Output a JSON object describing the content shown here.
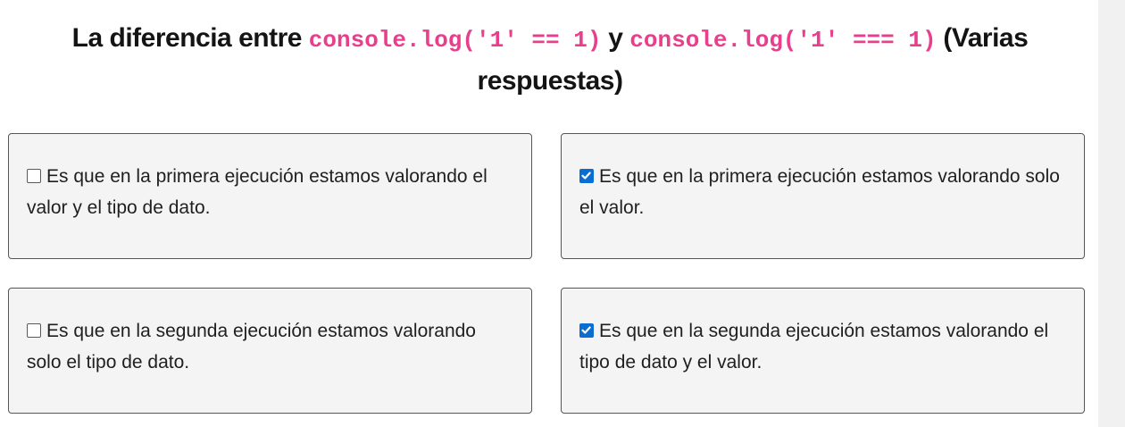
{
  "question": {
    "prefix": "La diferencia entre ",
    "code1": "console.log('1' == 1)",
    "connector": " y ",
    "code2": "console.log('1' === 1)",
    "suffix": " (Varias respuestas)"
  },
  "options": [
    {
      "text": "Es que en la primera ejecución estamos valorando el valor y el tipo de dato.",
      "checked": false
    },
    {
      "text": "Es que en la primera ejecución estamos valorando solo el valor.",
      "checked": true
    },
    {
      "text": "Es que en la segunda ejecución estamos valorando solo el tipo de dato.",
      "checked": false
    },
    {
      "text": "Es que en la segunda ejecución estamos valorando el tipo de dato y el valor.",
      "checked": true
    }
  ],
  "colors": {
    "code": "#e83e8c",
    "checkbox_checked": "#0a6ed1",
    "option_bg": "#f4f4f4"
  }
}
